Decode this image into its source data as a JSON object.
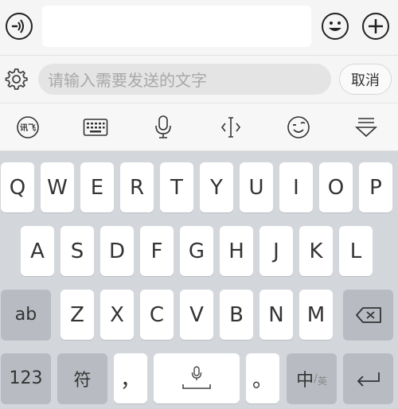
{
  "chatbar": {
    "input_value": "",
    "icons": [
      "voice-icon",
      "emoji-icon",
      "plus-icon"
    ]
  },
  "search": {
    "placeholder": "请输入需要发送的文字",
    "cancel_label": "取消"
  },
  "toolbar": {
    "icons": [
      "ime-logo-icon",
      "keyboard-icon",
      "microphone-icon",
      "text-cursor-icon",
      "wink-emoji-icon",
      "hide-keyboard-icon"
    ]
  },
  "keyboard": {
    "row1": [
      "Q",
      "W",
      "E",
      "R",
      "T",
      "Y",
      "U",
      "I",
      "O",
      "P"
    ],
    "row2": [
      "A",
      "S",
      "D",
      "F",
      "G",
      "H",
      "J",
      "K",
      "L"
    ],
    "row3": [
      "Z",
      "X",
      "C",
      "V",
      "B",
      "N",
      "M"
    ],
    "ab_label": "ab",
    "num_label": "123",
    "symbol_label": "符",
    "comma_label": "，",
    "period_label": "。",
    "lang_main": "中",
    "lang_sep": "/",
    "lang_alt": "英"
  }
}
